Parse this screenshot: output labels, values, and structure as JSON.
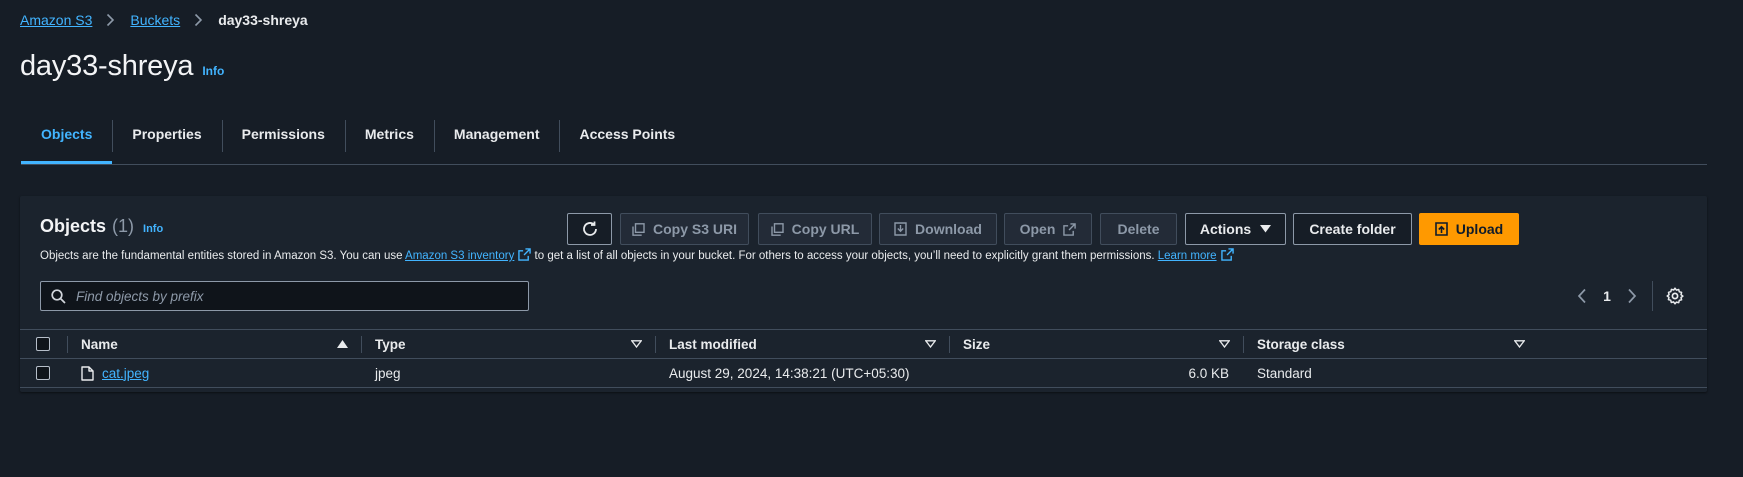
{
  "breadcrumb": {
    "root": "Amazon S3",
    "buckets": "Buckets",
    "current": "day33-shreya"
  },
  "page": {
    "title": "day33-shreya",
    "info": "Info"
  },
  "tabs": [
    {
      "label": "Objects",
      "active": true
    },
    {
      "label": "Properties"
    },
    {
      "label": "Permissions"
    },
    {
      "label": "Metrics"
    },
    {
      "label": "Management"
    },
    {
      "label": "Access Points"
    }
  ],
  "objects_panel": {
    "title": "Objects",
    "count": "(1)",
    "info": "Info",
    "desc_part1": "Objects are the fundamental entities stored in Amazon S3. You can use ",
    "desc_link1": "Amazon S3 inventory",
    "desc_part2": " to get a list of all objects in your bucket. For others to access your objects, you’ll need to explicitly grant them permissions. ",
    "desc_link2": "Learn more",
    "buttons": {
      "refresh": "",
      "copy_s3_uri": "Copy S3 URI",
      "copy_url": "Copy URL",
      "download": "Download",
      "open": "Open",
      "delete": "Delete",
      "actions": "Actions",
      "create_folder": "Create folder",
      "upload": "Upload"
    },
    "search_placeholder": "Find objects by prefix",
    "pagination": {
      "current_page": "1"
    }
  },
  "table": {
    "columns": {
      "name": "Name",
      "type": "Type",
      "last_modified": "Last modified",
      "size": "Size",
      "storage_class": "Storage class"
    },
    "rows": [
      {
        "name": "cat.jpeg",
        "type": "jpeg",
        "last_modified": "August 29, 2024, 14:38:21 (UTC+05:30)",
        "size": "6.0 KB",
        "storage_class": "Standard"
      }
    ]
  },
  "colors": {
    "accent": "#42b4ff",
    "primary_button": "#ff9900",
    "background": "#161d26"
  }
}
